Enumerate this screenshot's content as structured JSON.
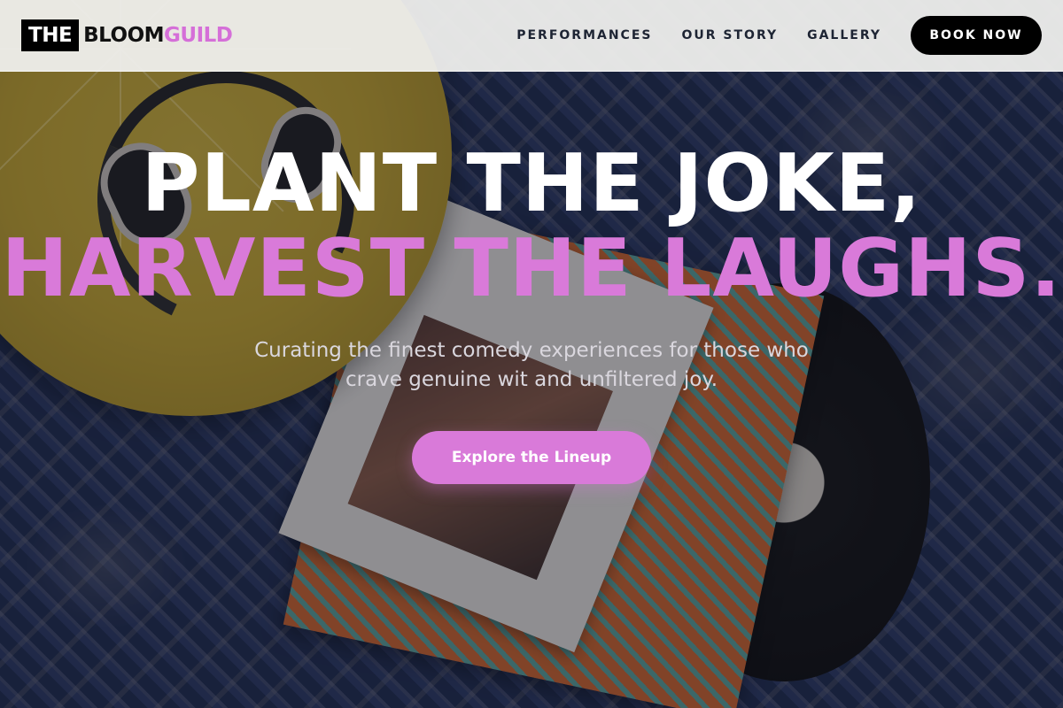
{
  "brand": {
    "box_text": "THE",
    "main_text": "BLOOM",
    "accent_text": "GUILD",
    "accent_color": "#d56fd8"
  },
  "nav": {
    "links": [
      "PERFORMANCES",
      "OUR STORY",
      "GALLERY"
    ],
    "cta_label": "BOOK NOW"
  },
  "hero": {
    "headline_line1": "PLANT THE JOKE,",
    "headline_line2": "HARVEST THE LAUGHS.",
    "subtitle": "Curating the finest comedy experiences for those who crave genuine wit and unfiltered joy.",
    "cta_label": "Explore the Lineup",
    "accent_color": "#d97ad9"
  }
}
